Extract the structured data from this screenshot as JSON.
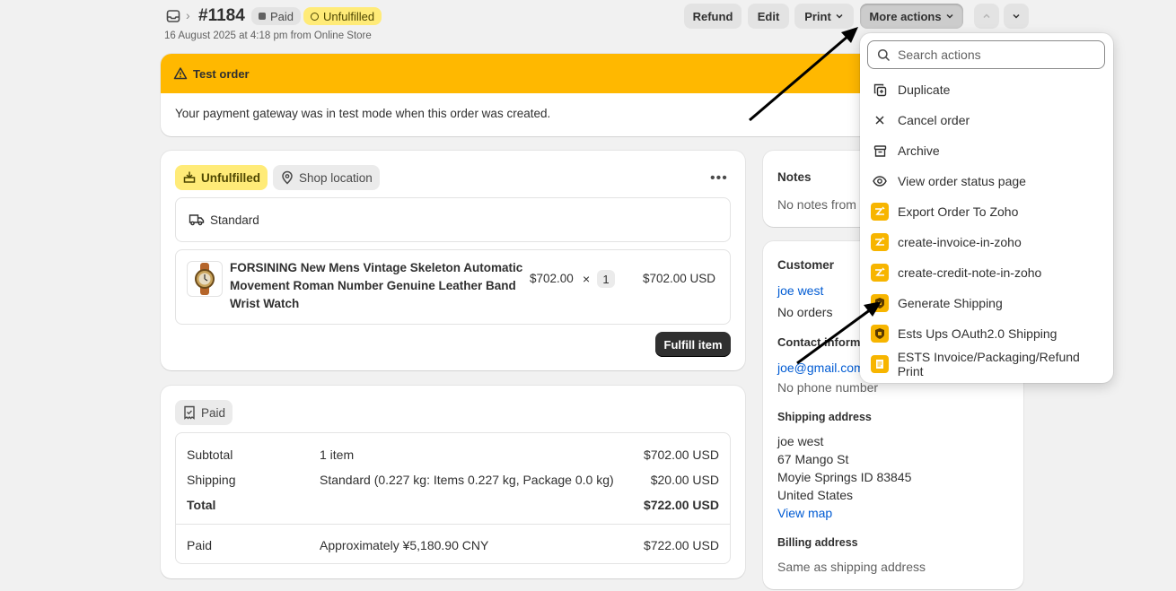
{
  "header": {
    "order_number": "#1184",
    "paid_badge": "Paid",
    "unfulfilled_badge": "Unfulfilled",
    "subtitle": "16 August 2025 at 4:18 pm from Online Store",
    "refund": "Refund",
    "edit": "Edit",
    "print": "Print",
    "more_actions": "More actions"
  },
  "banner": {
    "title": "Test order",
    "message": "Your payment gateway was in test mode when this order was created."
  },
  "fulfillment": {
    "status": "Unfulfilled",
    "location": "Shop location",
    "shipping_method": "Standard",
    "product_name": "FORSINING New Mens Vintage Skeleton Automatic Movement Roman Number Genuine Leather Band Wrist Watch",
    "price": "$702.00",
    "times": "×",
    "qty": "1",
    "line_total": "$702.00 USD",
    "fulfill_button": "Fulfill item"
  },
  "payment": {
    "status": "Paid",
    "rows": [
      {
        "label": "Subtotal",
        "detail": "1 item",
        "amount": "$702.00 USD"
      },
      {
        "label": "Shipping",
        "detail": "Standard (0.227 kg: Items 0.227 kg, Package 0.0 kg)",
        "amount": "$20.00 USD"
      },
      {
        "label": "Total",
        "detail": "",
        "amount": "$722.00 USD"
      }
    ],
    "paid_label": "Paid",
    "paid_detail": "Approximately ¥5,180.90 CNY",
    "paid_amount": "$722.00 USD"
  },
  "notes": {
    "title": "Notes",
    "text": "No notes from"
  },
  "customer": {
    "title": "Customer",
    "name": "joe west",
    "orders": "No orders",
    "contact_title": "Contact informa",
    "email": "joe@gmail.com",
    "phone": "No phone number",
    "shipping_title": "Shipping address",
    "address": [
      "joe west",
      "67 Mango St",
      "Moyie Springs ID 83845",
      "United States"
    ],
    "view_map": "View map",
    "billing_title": "Billing address",
    "billing_text": "Same as shipping address"
  },
  "menu": {
    "search_placeholder": "Search actions",
    "items": [
      {
        "label": "Duplicate",
        "icon": "duplicate-icon"
      },
      {
        "label": "Cancel order",
        "icon": "close-icon"
      },
      {
        "label": "Archive",
        "icon": "archive-icon"
      },
      {
        "label": "View order status page",
        "icon": "eye-icon"
      },
      {
        "label": "Export Order To Zoho",
        "icon": "zoho-app-icon"
      },
      {
        "label": "create-invoice-in-zoho",
        "icon": "zoho-app-icon"
      },
      {
        "label": "create-credit-note-in-zoho",
        "icon": "zoho-app-icon"
      },
      {
        "label": "Generate Shipping",
        "icon": "shipping-app-icon"
      },
      {
        "label": "Ests Ups OAuth2.0 Shipping",
        "icon": "shipping-app-icon"
      },
      {
        "label": "ESTS Invoice/Packaging/Refund Print",
        "icon": "print-app-icon"
      }
    ]
  },
  "colors": {
    "banner": "#ffb800",
    "unfulfilled_badge": "#ffeb78",
    "paid_badge": "#e3e3e3",
    "link": "#005bd3",
    "primary_button": "#303030"
  }
}
